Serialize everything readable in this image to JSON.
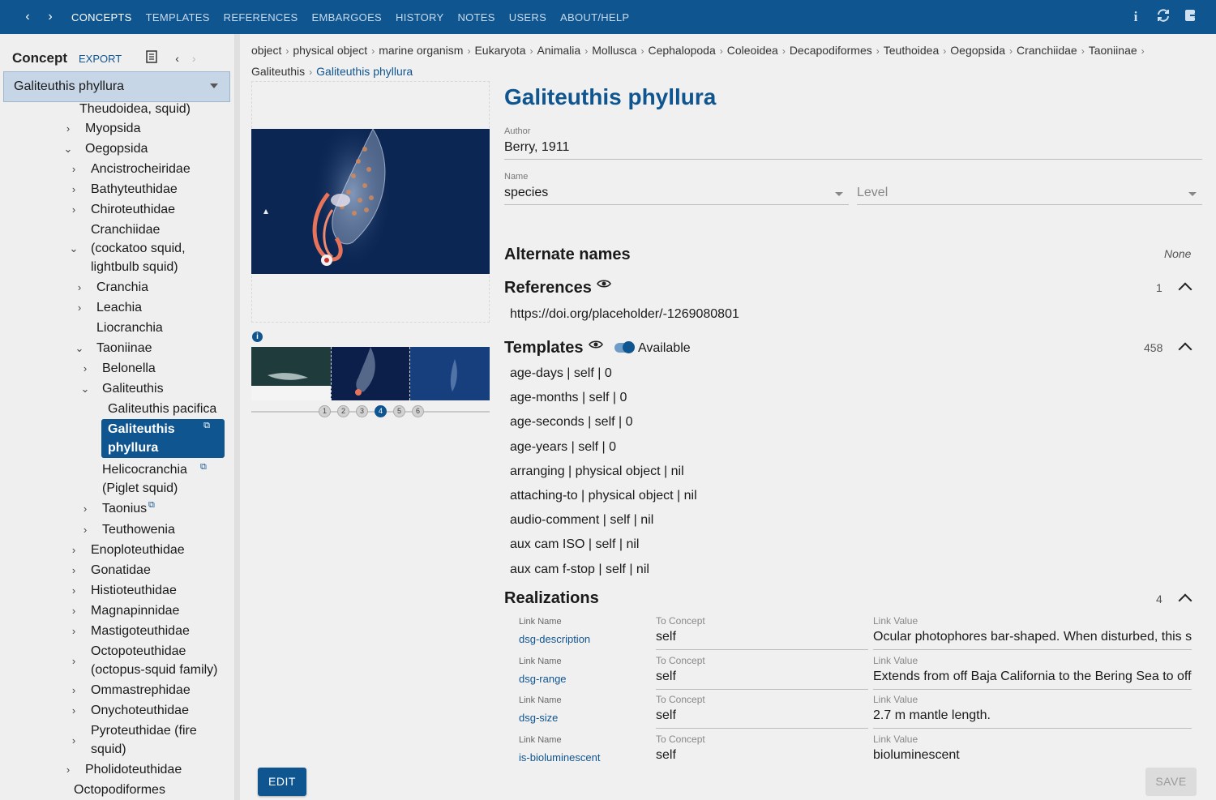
{
  "topbar": {
    "back_icon": "chevron-left",
    "forward_icon": "chevron-right",
    "menu": [
      "CONCEPTS",
      "TEMPLATES",
      "REFERENCES",
      "EMBARGOES",
      "HISTORY",
      "NOTES",
      "USERS",
      "ABOUT/HELP"
    ],
    "active_menu": "CONCEPTS",
    "icons": [
      "info-icon",
      "sync-icon",
      "logout-icon"
    ]
  },
  "sidebar": {
    "title": "Concept",
    "export_label": "EXPORT",
    "selected_concept": "Galiteuthis phyllura",
    "tree": [
      "Theudoidea, squid)",
      "Myopsida",
      "Oegopsida",
      "Ancistrocheiridae",
      "Bathyteuthidae",
      "Chiroteuthidae",
      "Cranchiidae",
      "(cockatoo squid,",
      "lightbulb squid)",
      "Cranchia",
      "Leachia",
      "Liocranchia",
      "Taoniinae",
      "Belonella",
      "Galiteuthis",
      "Galiteuthis pacifica",
      "Galiteuthis",
      "phyllura",
      "Helicocranchia",
      "(Piglet squid)",
      "Taonius",
      "Teuthowenia",
      "Enoploteuthidae",
      "Gonatidae",
      "Histioteuthidae",
      "Magnapinnidae",
      "Mastigoteuthidae",
      "Octopoteuthidae",
      "(octopus-squid family)",
      "Ommastrephidae",
      "Onychoteuthidae",
      "Pyroteuthidae (fire",
      "squid)",
      "Pholidoteuthidae",
      "Octopodiformes"
    ]
  },
  "breadcrumb": {
    "items": [
      "object",
      "physical object",
      "marine organism",
      "Eukaryota",
      "Animalia",
      "Mollusca",
      "Cephalopoda",
      "Coleoidea",
      "Decapodiformes",
      "Teuthoidea",
      "Oegopsida",
      "Cranchiidae",
      "Taoniinae",
      "Galiteuthis"
    ],
    "current": "Galiteuthis phyllura"
  },
  "media": {
    "pager": [
      "1",
      "2",
      "3",
      "4",
      "5",
      "6"
    ],
    "active_page": "4",
    "info_glyph": "i"
  },
  "concept": {
    "name": "Galiteuthis phyllura",
    "author_label": "Author",
    "author": "Berry, 1911",
    "name_label": "Name",
    "rank_name": "species",
    "rank_level_placeholder": "Level"
  },
  "alternate_names": {
    "title": "Alternate names",
    "value": "None"
  },
  "references": {
    "title": "References",
    "count": "1",
    "items": [
      "https://doi.org/placeholder/-1269080801"
    ]
  },
  "templates": {
    "title": "Templates",
    "toggle_label": "Available",
    "count": "458",
    "items": [
      "age-days | self | 0",
      "age-months | self | 0",
      "age-seconds | self | 0",
      "age-years | self | 0",
      "arranging | physical object | nil",
      "attaching-to | physical object | nil",
      "audio-comment | self | nil",
      "aux cam ISO | self | nil",
      "aux cam f-stop | self | nil"
    ]
  },
  "realizations": {
    "title": "Realizations",
    "count": "4",
    "link_name_label": "Link Name",
    "to_concept_label": "To Concept",
    "link_value_label": "Link Value",
    "rows": [
      {
        "link_name": "dsg-description",
        "to_concept": "self",
        "link_value": "Ocular photophores bar-shaped. When disturbed, this sq"
      },
      {
        "link_name": "dsg-range",
        "to_concept": "self",
        "link_value": "Extends from off Baja California to the Bering Sea to off"
      },
      {
        "link_name": "dsg-size",
        "to_concept": "self",
        "link_value": "2.7 m mantle length."
      },
      {
        "link_name": "is-bioluminescent",
        "to_concept": "self",
        "link_value": "bioluminescent"
      }
    ]
  },
  "buttons": {
    "edit": "EDIT",
    "save": "SAVE"
  },
  "colors": {
    "brand": "#0f5590",
    "background": "#f0f0f0"
  }
}
